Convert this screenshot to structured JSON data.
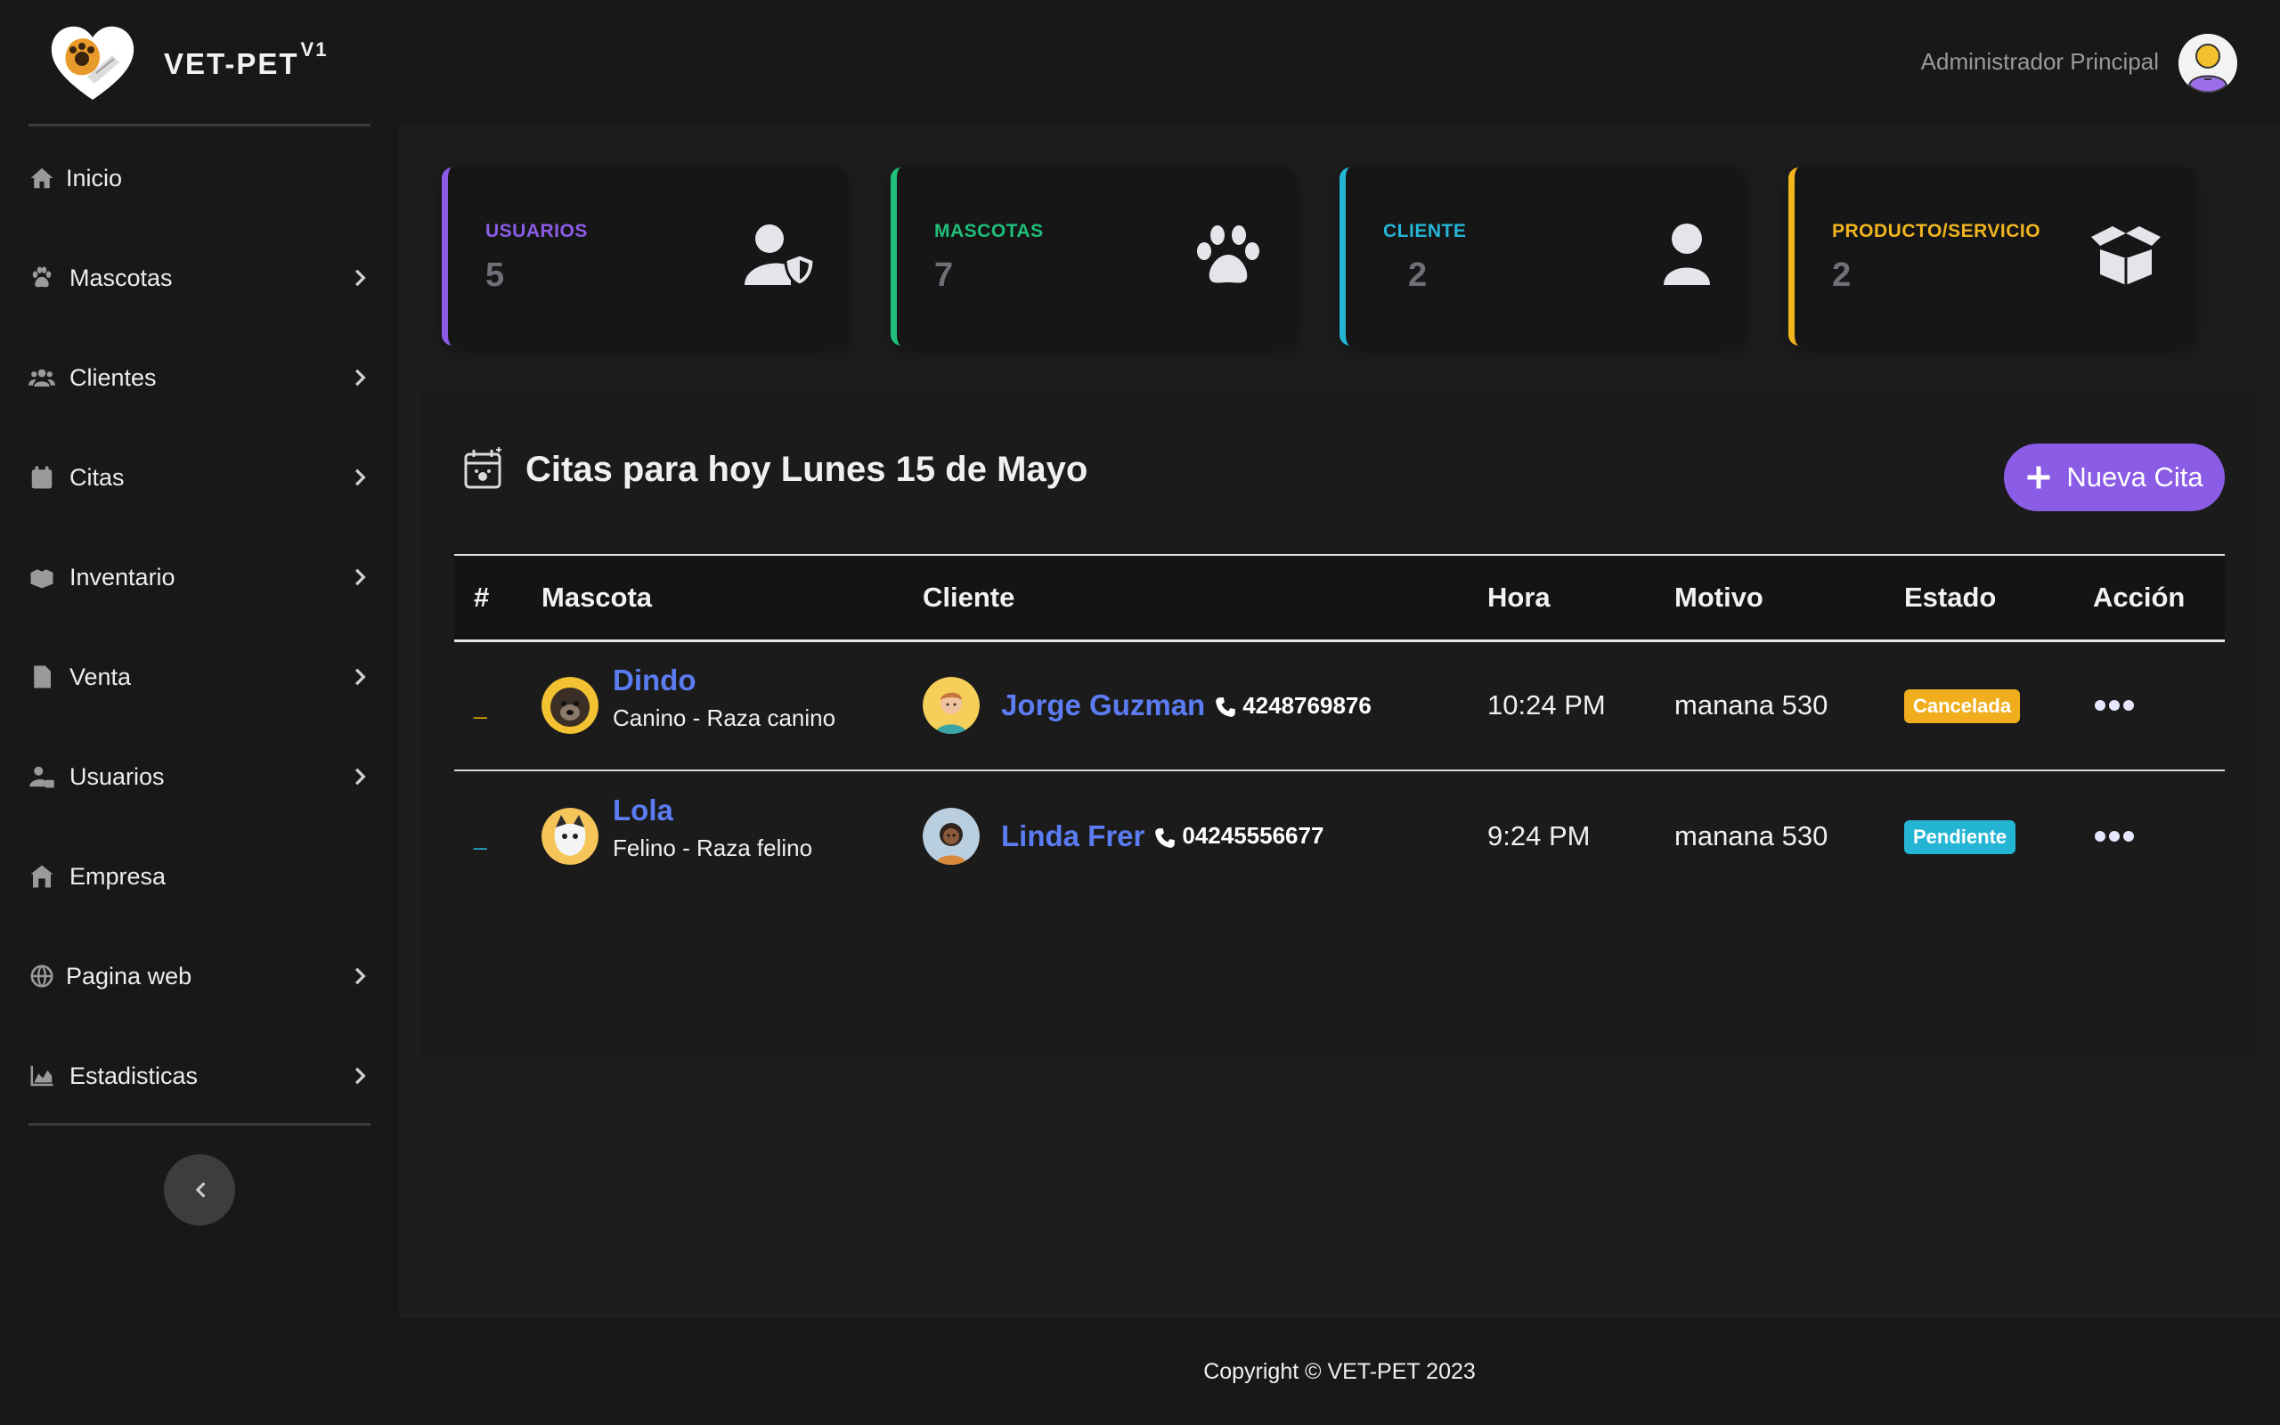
{
  "brand": {
    "name": "VET-PET",
    "version": "V1"
  },
  "user": {
    "name": "Administrador Principal"
  },
  "sidebar": {
    "items": [
      {
        "label": "Inicio",
        "icon": "home-icon",
        "has_submenu": false
      },
      {
        "label": "Mascotas",
        "icon": "paw-icon",
        "has_submenu": true
      },
      {
        "label": "Clientes",
        "icon": "users-icon",
        "has_submenu": true
      },
      {
        "label": "Citas",
        "icon": "calendar-icon",
        "has_submenu": true
      },
      {
        "label": "Inventario",
        "icon": "boxes-icon",
        "has_submenu": true
      },
      {
        "label": "Venta",
        "icon": "invoice-icon",
        "has_submenu": true
      },
      {
        "label": "Usuarios",
        "icon": "user-lock-icon",
        "has_submenu": true
      },
      {
        "label": "Empresa",
        "icon": "building-icon",
        "has_submenu": false
      },
      {
        "label": "Pagina web",
        "icon": "globe-icon",
        "has_submenu": true
      },
      {
        "label": "Estadisticas",
        "icon": "chart-area-icon",
        "has_submenu": true
      }
    ]
  },
  "cards": [
    {
      "title": "USUARIOS",
      "value": "5",
      "color": "#8b5ce6",
      "icon": "user-shield-icon"
    },
    {
      "title": "MASCOTAS",
      "value": "7",
      "color": "#1fbf7a",
      "icon": "paw-icon"
    },
    {
      "title": "CLIENTE",
      "value": "2",
      "color": "#25b5d6",
      "icon": "user-icon"
    },
    {
      "title": "PRODUCTO/SERVICIO",
      "value": "2",
      "color": "#f2b51f",
      "icon": "box-open-icon"
    }
  ],
  "appointments": {
    "title": "Citas para hoy Lunes 15 de Mayo",
    "new_button": "Nueva Cita",
    "headers": [
      "#",
      "Mascota",
      "Cliente",
      "Hora",
      "Motivo",
      "Estado",
      "Acción"
    ],
    "rows": [
      {
        "num": "_",
        "pet_name": "Dindo",
        "pet_species": "Canino",
        "pet_separator": "-",
        "pet_breed": "Raza canino",
        "client_name": "Jorge Guzman",
        "client_phone": "4248769876",
        "time": "10:24 PM",
        "reason": "manana 530",
        "status": "Cancelada",
        "status_color": "#f0ae1e"
      },
      {
        "num": "_",
        "pet_name": "Lola",
        "pet_species": "Felino",
        "pet_separator": "-",
        "pet_breed": "Raza felino",
        "client_name": "Linda Frer",
        "client_phone": "04245556677",
        "time": "9:24 PM",
        "reason": "manana 530",
        "status": "Pendiente",
        "status_color": "#23b5d3"
      }
    ]
  },
  "footer": {
    "text": "Copyright © VET-PET 2023"
  }
}
